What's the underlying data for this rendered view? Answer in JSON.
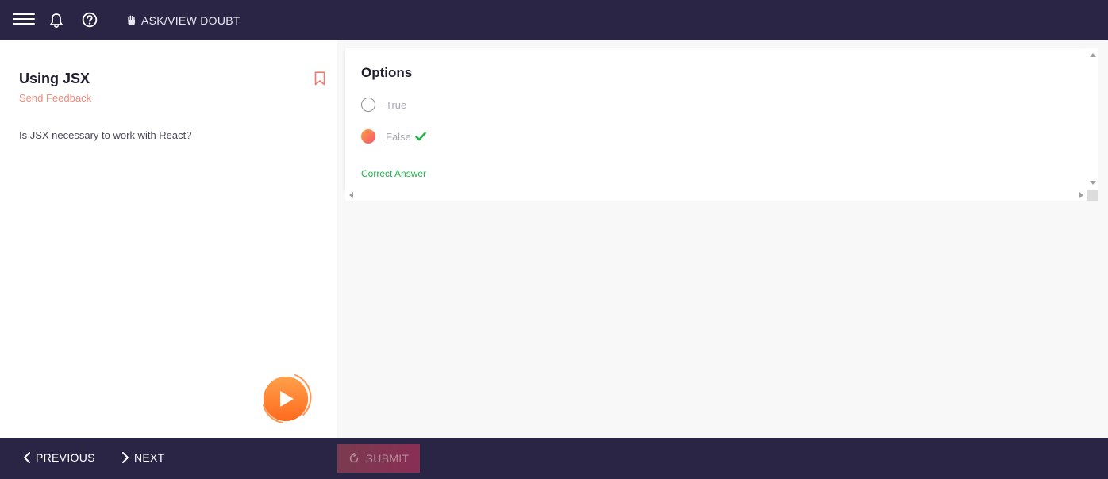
{
  "header": {
    "doubt_label": "ASK/VIEW DOUBT"
  },
  "lesson": {
    "title": "Using JSX",
    "feedback_label": "Send Feedback",
    "question": "Is JSX necessary to work with React?"
  },
  "options": {
    "heading": "Options",
    "items": [
      {
        "label": "True",
        "selected": false
      },
      {
        "label": "False",
        "selected": true,
        "correct": true
      }
    ],
    "result_label": "Correct Answer"
  },
  "footer": {
    "previous_label": "PREVIOUS",
    "next_label": "NEXT",
    "submit_label": "SUBMIT"
  },
  "colors": {
    "bar_background": "#2a2545",
    "accent_orange": "#ff8a3d",
    "feedback_pink": "#f08a7e",
    "correct_green": "#22b24c"
  },
  "icons": [
    "menu-icon",
    "bell-icon",
    "help-icon",
    "hand-icon",
    "bookmark-icon",
    "play-icon",
    "check-icon",
    "chevron-left-icon",
    "chevron-right-icon",
    "refresh-icon"
  ]
}
